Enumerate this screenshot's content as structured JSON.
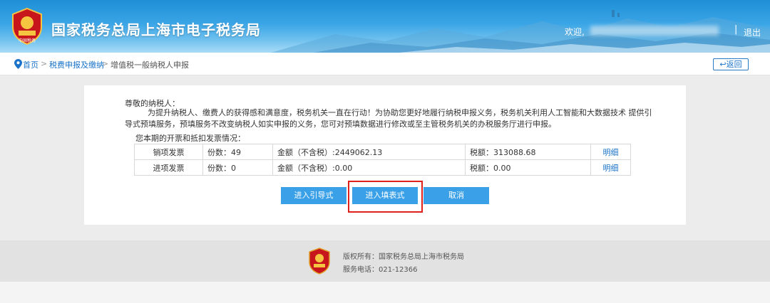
{
  "header": {
    "site_title": "国家税务总局上海市电子税务局",
    "welcome": "欢迎,",
    "separator": "|",
    "logout": "退出",
    "logo_text": "中国税务"
  },
  "breadcrumb": {
    "home": "首页",
    "sep": ">",
    "level1": "税费申报及缴纳",
    "current": "增值税一般纳税人申报",
    "back": "返回"
  },
  "notice": {
    "greeting": "尊敬的纳税人：",
    "body": "为提升纳税人、缴费人的获得感和满意度，税务机关一直在行动！为协助您更好地履行纳税申报义务，税务机关利用人工智能和大数据技术 提供引导式预填服务，预填服务不改变纳税人如实申报的义务，您可对预填数据进行修改或至主管税务机关的办税服务厅进行申报。",
    "summary": "您本期的开票和抵扣发票情况："
  },
  "invoices": [
    {
      "type": "销项发票",
      "count": "份数：49",
      "amount": "金额（不含税）:2449062.13",
      "tax": "税额：313088.68",
      "detail": "明细"
    },
    {
      "type": "进项发票",
      "count": "份数：0",
      "amount": "金额（不含税）:0.00",
      "tax": "税额：0.00",
      "detail": "明细"
    }
  ],
  "buttons": {
    "guide": "进入引导式",
    "form": "进入填表式",
    "cancel": "取消"
  },
  "footer": {
    "copyright": "版权所有：国家税务总局上海市税务局",
    "phone": "服务电话：021-12366"
  },
  "colors": {
    "brand_blue": "#1f8fd6",
    "button_blue": "#3aa0e8",
    "link_blue": "#1a73c9",
    "highlight_red": "#e0201b"
  }
}
